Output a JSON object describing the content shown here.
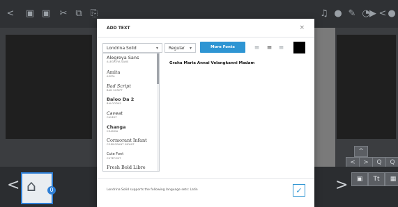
{
  "toolbar": {
    "icons": [
      "back-icon",
      "save-icon",
      "save-as-icon",
      "cut-icon",
      "copy-icon",
      "music-icon",
      "mic-icon",
      "pen-icon",
      "timer-icon",
      "skip-icon",
      "play-icon",
      "share-icon",
      "more-icon"
    ]
  },
  "dialog": {
    "title": "ADD TEXT",
    "close_label": "×",
    "font_select": {
      "value": "Londrina Solid",
      "caret": "▾"
    },
    "weight_select": {
      "value": "Regular",
      "caret": "▾"
    },
    "more_fonts_label": "More Fonts",
    "text_color": "#000000",
    "font_list": [
      {
        "name": "Alegreya Sans",
        "tag": "ALEGREYA SANS"
      },
      {
        "name": "Amita",
        "tag": "AMITA"
      },
      {
        "name": "Bad Script",
        "tag": "BAD SCRIPT"
      },
      {
        "name": "Baloo Da 2",
        "tag": "BALOODA2"
      },
      {
        "name": "Caveat",
        "tag": "CAVEAT"
      },
      {
        "name": "Changa",
        "tag": "CHANGA"
      },
      {
        "name": "Cormorant Infant",
        "tag": "CORMORANT INFANT"
      },
      {
        "name": "Cute Font",
        "tag": "CUTEFONT"
      },
      {
        "name": "Fresh Bold Libre",
        "tag": ""
      }
    ],
    "preview_text": "Graha Maria Annai Velangkanni Madam",
    "footer_note": "Londrina Solid supports the following language sets: Latin",
    "ok_label": "✓"
  },
  "bottom_bar": {
    "prev_label": "<",
    "next_label": ">",
    "thumb_badge": "0",
    "buttons": [
      "▣",
      "Tt",
      "▦"
    ]
  },
  "zoom_controls": [
    "<",
    ">",
    "Q",
    "Q",
    ">"
  ]
}
